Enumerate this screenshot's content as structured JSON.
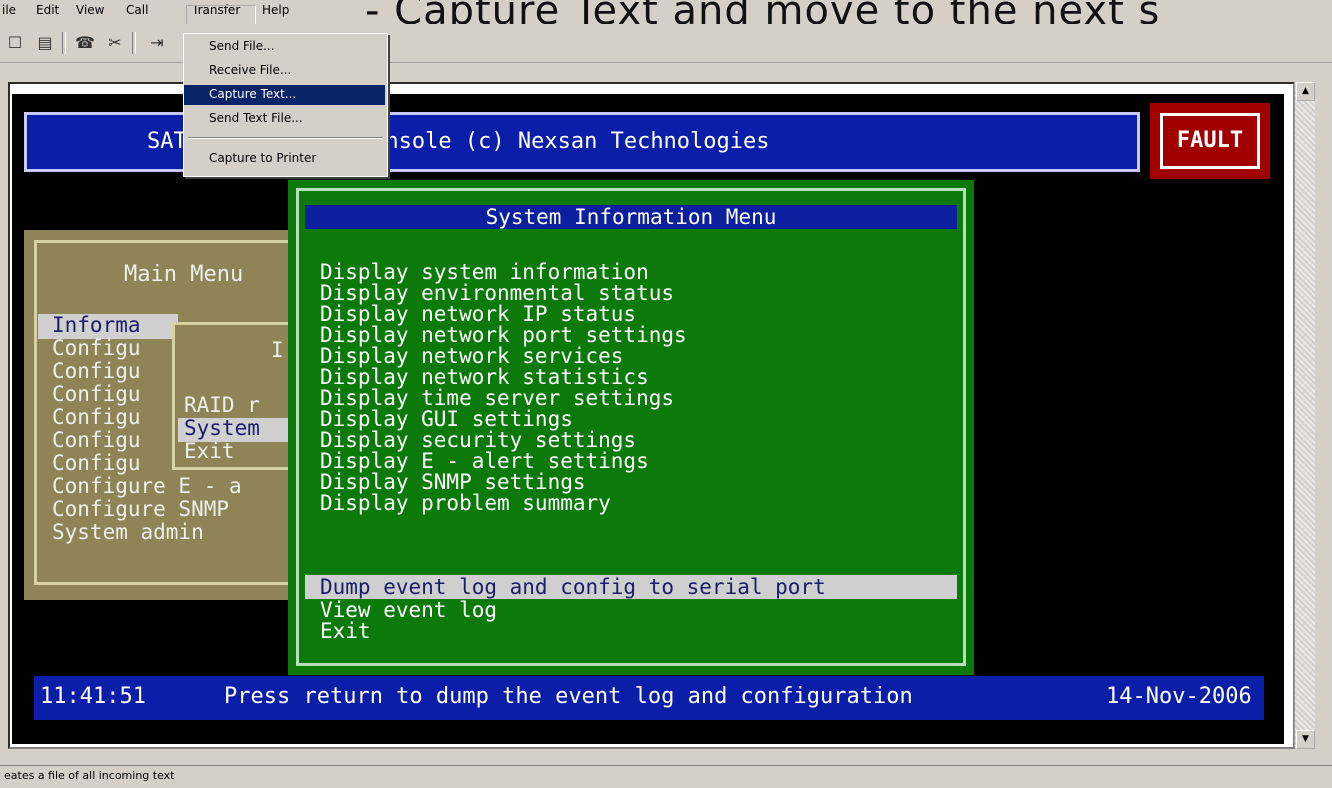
{
  "menubar": {
    "items": [
      "ile",
      "Edit",
      "View",
      "Call",
      "Transfer",
      "Help"
    ],
    "banner": "- Capture Text and move to the next s"
  },
  "toolbar": {
    "icons": [
      "new-icon",
      "open-icon",
      "disconnect-icon",
      "dial-icon",
      "send-icon"
    ]
  },
  "dropdown": {
    "items": [
      "Send File...",
      "Receive File...",
      "Capture Text...",
      "Send Text File...",
      "Capture to Printer"
    ],
    "highlighted": 2
  },
  "terminal": {
    "title": "SATA           management console (c) Nexsan Technologies",
    "fault": "FAULT",
    "main_menu": {
      "title": "Main Menu",
      "items": [
        "Informa",
        "Configu",
        "Configu",
        "Configu",
        "Configu",
        "Configu",
        "Configu",
        "Configure E - a",
        "Configure SNMP",
        "System admin"
      ]
    },
    "sub_menu": {
      "title": "I",
      "items": [
        "RAID r",
        "System",
        "Exit"
      ]
    },
    "system_info": {
      "title": "System Information Menu",
      "items": [
        "Display system information",
        "Display environmental status",
        "Display network IP status",
        "Display network port settings",
        "Display network services",
        "Display network statistics",
        "Display time server settings",
        "Display GUI settings",
        "Display security settings",
        "Display E - alert settings",
        "Display SNMP settings",
        "Display problem summary",
        "Dump event log and config to serial port",
        "View event log",
        "Exit"
      ],
      "selected": 12
    },
    "bottom": {
      "time": "11:41:51",
      "message": "Press return to dump the event log and configuration",
      "date": "14-Nov-2006"
    }
  },
  "status": {
    "text": "eates a file of all incoming text"
  }
}
